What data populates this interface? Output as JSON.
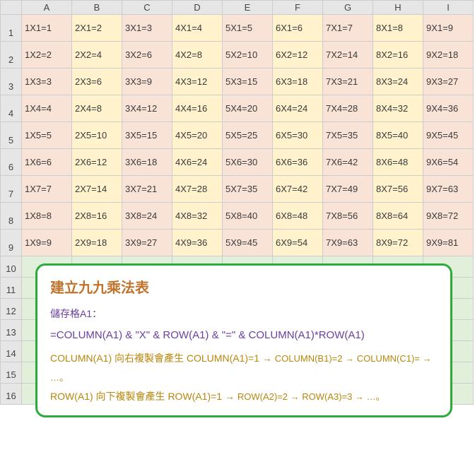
{
  "columns": [
    "A",
    "B",
    "C",
    "D",
    "E",
    "F",
    "G",
    "H",
    "I"
  ],
  "rows": [
    "1",
    "2",
    "3",
    "4",
    "5",
    "6",
    "7",
    "8",
    "9",
    "10",
    "11",
    "12",
    "13",
    "14",
    "15",
    "16"
  ],
  "chart_data": {
    "type": "table",
    "title": "九九乘法表",
    "columns": [
      "A",
      "B",
      "C",
      "D",
      "E",
      "F",
      "G",
      "H",
      "I"
    ],
    "data": [
      [
        "1X1=1",
        "2X1=2",
        "3X1=3",
        "4X1=4",
        "5X1=5",
        "6X1=6",
        "7X1=7",
        "8X1=8",
        "9X1=9"
      ],
      [
        "1X2=2",
        "2X2=4",
        "3X2=6",
        "4X2=8",
        "5X2=10",
        "6X2=12",
        "7X2=14",
        "8X2=16",
        "9X2=18"
      ],
      [
        "1X3=3",
        "2X3=6",
        "3X3=9",
        "4X3=12",
        "5X3=15",
        "6X3=18",
        "7X3=21",
        "8X3=24",
        "9X3=27"
      ],
      [
        "1X4=4",
        "2X4=8",
        "3X4=12",
        "4X4=16",
        "5X4=20",
        "6X4=24",
        "7X4=28",
        "8X4=32",
        "9X4=36"
      ],
      [
        "1X5=5",
        "2X5=10",
        "3X5=15",
        "4X5=20",
        "5X5=25",
        "6X5=30",
        "7X5=35",
        "8X5=40",
        "9X5=45"
      ],
      [
        "1X6=6",
        "2X6=12",
        "3X6=18",
        "4X6=24",
        "5X6=30",
        "6X6=36",
        "7X6=42",
        "8X6=48",
        "9X6=54"
      ],
      [
        "1X7=7",
        "2X7=14",
        "3X7=21",
        "4X7=28",
        "5X7=35",
        "6X7=42",
        "7X7=49",
        "8X7=56",
        "9X7=63"
      ],
      [
        "1X8=8",
        "2X8=16",
        "3X8=24",
        "4X8=32",
        "5X8=40",
        "6X8=48",
        "7X8=56",
        "8X8=64",
        "9X8=72"
      ],
      [
        "1X9=9",
        "2X9=18",
        "3X9=27",
        "4X9=36",
        "5X9=45",
        "6X9=54",
        "7X9=63",
        "8X9=72",
        "9X9=81"
      ]
    ]
  },
  "info": {
    "title": "建立九九乘法表",
    "sub": "儲存格A1：",
    "formula": "=COLUMN(A1) & \"X\" & ROW(A1) & \"=\" & COLUMN(A1)*ROW(A1)",
    "note1a": "COLUMN(A1) 向右複製會產生 COLUMN(A1)=1 → ",
    "note1b": "COLUMN(B1)=2 → COLUMN(C1)= → …。",
    "note2a": "ROW(A1) 向下複製會產生 ROW(A1)=1 → ",
    "note2b": "ROW(A2)=2 → ROW(A3)=3 → …。"
  }
}
